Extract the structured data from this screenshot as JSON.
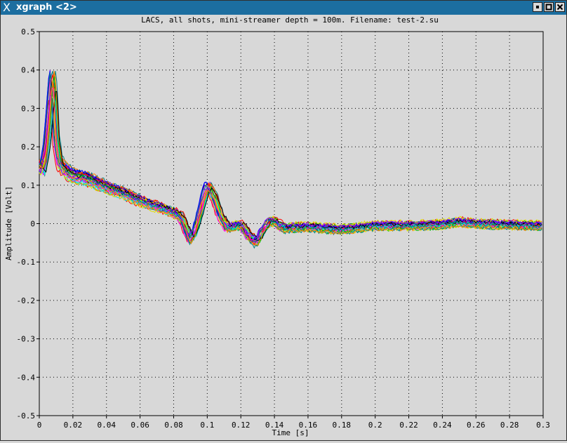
{
  "window": {
    "title": "xgraph <2>",
    "buttons": [
      "minimize-icon",
      "maximize-icon",
      "close-icon"
    ],
    "titlebar_color": "#1c6ea0"
  },
  "chart_data": {
    "type": "line",
    "title": "LACS, all shots, mini-streamer depth = 100m. Filename: test-2.su",
    "xlabel": "Time [s]",
    "ylabel": "Amplitude [Volt]",
    "xlim": [
      0,
      0.3
    ],
    "ylim": [
      -0.5,
      0.5
    ],
    "xticks": [
      "0",
      "0.02",
      "0.04",
      "0.06",
      "0.08",
      "0.1",
      "0.12",
      "0.14",
      "0.16",
      "0.18",
      "0.2",
      "0.22",
      "0.24",
      "0.26",
      "0.28",
      "0.3"
    ],
    "yticks": [
      "-0.5",
      "-0.4",
      "-0.3",
      "-0.2",
      "-0.1",
      "0",
      "0.1",
      "0.2",
      "0.3",
      "0.4",
      "0.5"
    ],
    "grid": true,
    "grid_style": "dotted",
    "background": "#d8d8d8",
    "series_colors": [
      "#0000ff",
      "#ff0000",
      "#00c000",
      "#ff00ff",
      "#00e0e0",
      "#e0e000",
      "#000000",
      "#8000ff",
      "#008080",
      "#ff8000"
    ],
    "representative_trace": {
      "x": [
        0,
        0.002,
        0.004,
        0.006,
        0.007,
        0.008,
        0.009,
        0.01,
        0.012,
        0.015,
        0.02,
        0.03,
        0.04,
        0.05,
        0.06,
        0.07,
        0.08,
        0.085,
        0.088,
        0.09,
        0.093,
        0.096,
        0.099,
        0.101,
        0.104,
        0.108,
        0.112,
        0.116,
        0.12,
        0.125,
        0.128,
        0.13,
        0.133,
        0.136,
        0.139,
        0.142,
        0.146,
        0.15,
        0.16,
        0.18,
        0.2,
        0.22,
        0.24,
        0.25,
        0.26,
        0.28,
        0.3
      ],
      "y": [
        0.15,
        0.14,
        0.18,
        0.27,
        0.33,
        0.37,
        0.32,
        0.22,
        0.16,
        0.14,
        0.125,
        0.115,
        0.095,
        0.08,
        0.06,
        0.045,
        0.03,
        0.015,
        -0.02,
        -0.04,
        -0.02,
        0.03,
        0.08,
        0.095,
        0.07,
        0.02,
        -0.01,
        -0.008,
        -0.002,
        -0.03,
        -0.045,
        -0.045,
        -0.02,
        0.0,
        0.008,
        0.0,
        -0.012,
        -0.01,
        -0.008,
        -0.015,
        -0.005,
        -0.005,
        -0.002,
        0.005,
        0.0,
        -0.003,
        -0.005
      ]
    },
    "trace_count": 30
  }
}
